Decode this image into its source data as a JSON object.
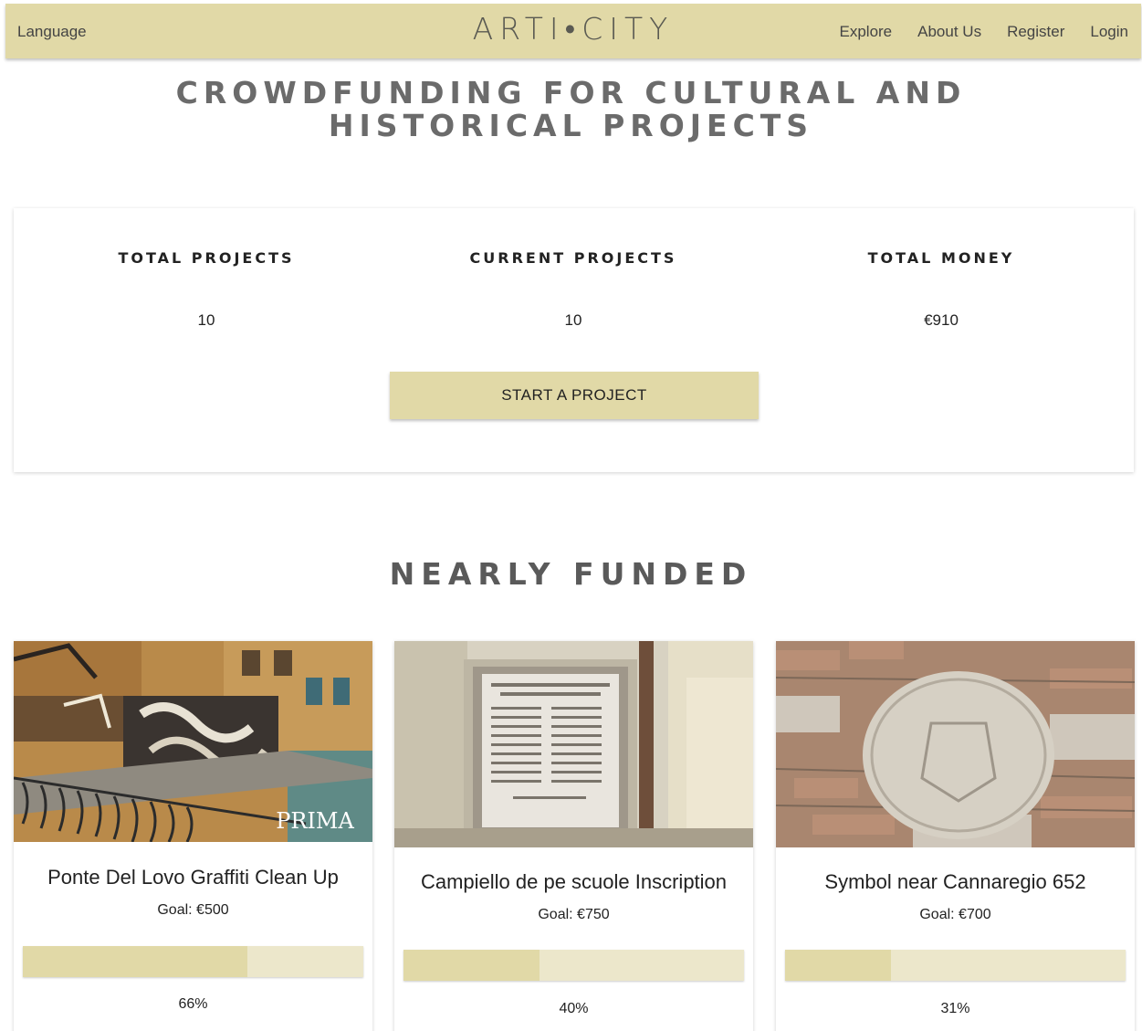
{
  "nav": {
    "language_label": "Language",
    "brand": "ARTI•CITY",
    "links": [
      "Explore",
      "About Us",
      "Register",
      "Login"
    ]
  },
  "hero": {
    "title": "CROWDFUNDING FOR CULTURAL AND HISTORICAL PROJECTS"
  },
  "stats": {
    "total_projects_label": "TOTAL PROJECTS",
    "total_projects_value": "10",
    "current_projects_label": "CURRENT PROJECTS",
    "current_projects_value": "10",
    "total_money_label": "TOTAL MONEY",
    "total_money_value": "€910",
    "start_button_label": "START A PROJECT"
  },
  "nearly_funded": {
    "title": "NEARLY FUNDED",
    "projects": [
      {
        "title": "Ponte Del Lovo Graffiti Clean Up",
        "goal": "Goal: €500",
        "percent_label": "66%",
        "progress": 0.66,
        "image_caption": "PRIMA"
      },
      {
        "title": "Campiello de pe scuole Inscription",
        "goal": "Goal: €750",
        "percent_label": "40%",
        "progress": 0.4
      },
      {
        "title": "Symbol near Cannaregio 652",
        "goal": "Goal: €700",
        "percent_label": "31%",
        "progress": 0.31
      }
    ]
  },
  "colors": {
    "accent": "#e1d9a7",
    "progress_track": "#ece7cb"
  }
}
